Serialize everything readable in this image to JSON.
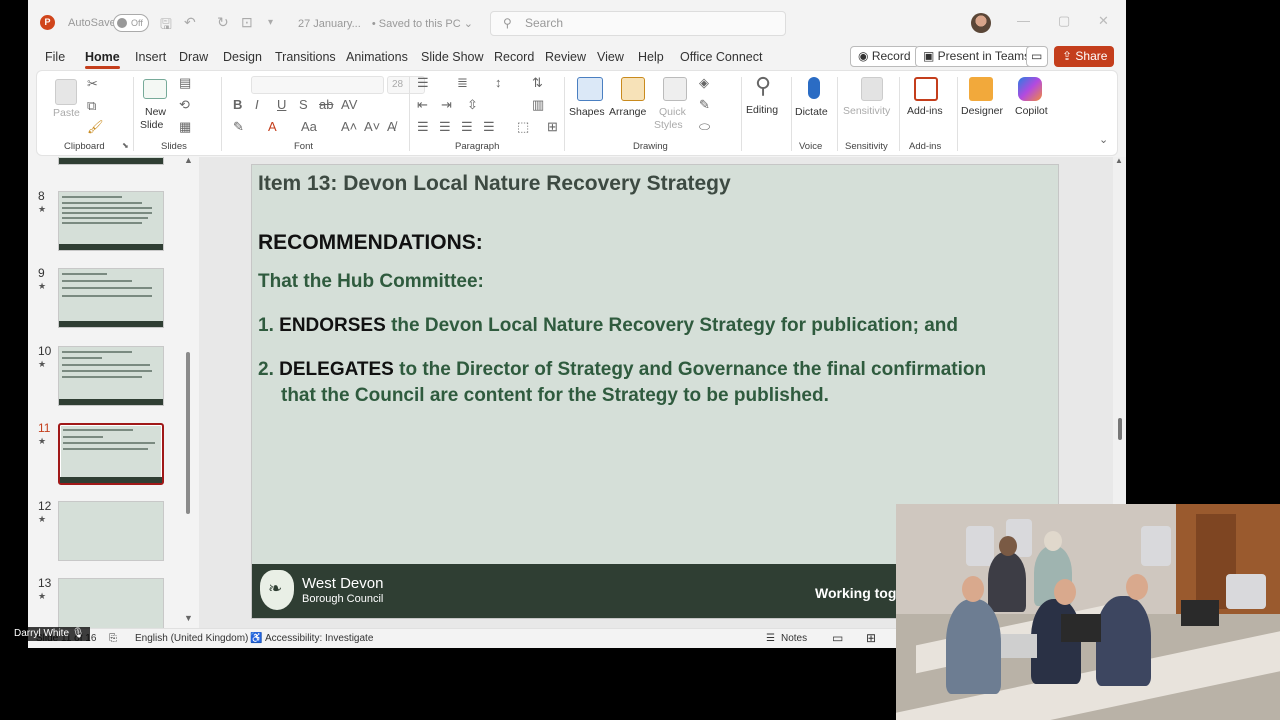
{
  "titlebar": {
    "autosave_label": "AutoSave",
    "autosave_state": "Off",
    "doc_title": "27 January...",
    "save_status": "• Saved to this PC ⌄",
    "search_placeholder": "Search"
  },
  "tabs": [
    "File",
    "Home",
    "Insert",
    "Draw",
    "Design",
    "Transitions",
    "Animations",
    "Slide Show",
    "Record",
    "Review",
    "View",
    "Help",
    "Office Connect"
  ],
  "actions": {
    "record": "Record",
    "present_in_teams": "Present in Teams",
    "share": "Share"
  },
  "ribbon": {
    "groups": [
      "Clipboard",
      "Slides",
      "Font",
      "Paragraph",
      "Drawing",
      "Voice",
      "Sensitivity",
      "Add-ins"
    ],
    "paste": "Paste",
    "new_slide_1": "New",
    "new_slide_2": "Slide",
    "font_size": "28",
    "shapes": "Shapes",
    "arrange": "Arrange",
    "quick_styles_1": "Quick",
    "quick_styles_2": "Styles",
    "editing": "Editing",
    "dictate": "Dictate",
    "sensitivity": "Sensitivity",
    "addins": "Add-ins",
    "designer": "Designer",
    "copilot": "Copilot"
  },
  "thumbnails": [
    {
      "num": "8"
    },
    {
      "num": "9"
    },
    {
      "num": "10"
    },
    {
      "num": "11",
      "selected": true
    },
    {
      "num": "12"
    },
    {
      "num": "13"
    }
  ],
  "slide": {
    "title": "Item 13: Devon Local Nature Recovery Strategy",
    "recommendations": "RECOMMENDATIONS:",
    "hub": "That the Hub Committee:",
    "item1_num": "1.",
    "item1_kw": "ENDORSES",
    "item1_text": "the Devon Local Nature Recovery Strategy for publication; and",
    "item2_num": "2.",
    "item2_kw": "DELEGATES",
    "item2_text": "to the Director of Strategy and Governance the final confirmation",
    "item2_cont": "that the Council are content for the Strategy to be published.",
    "org_line1": "West Devon",
    "org_line2": "Borough Council",
    "tagline": "Working tog"
  },
  "statusbar": {
    "slide_info": "Slide 11 of 16",
    "language": "English (United Kingdom)",
    "accessibility": "Accessibility: Investigate",
    "notes": "Notes"
  },
  "speaker_name": "Darryl White"
}
